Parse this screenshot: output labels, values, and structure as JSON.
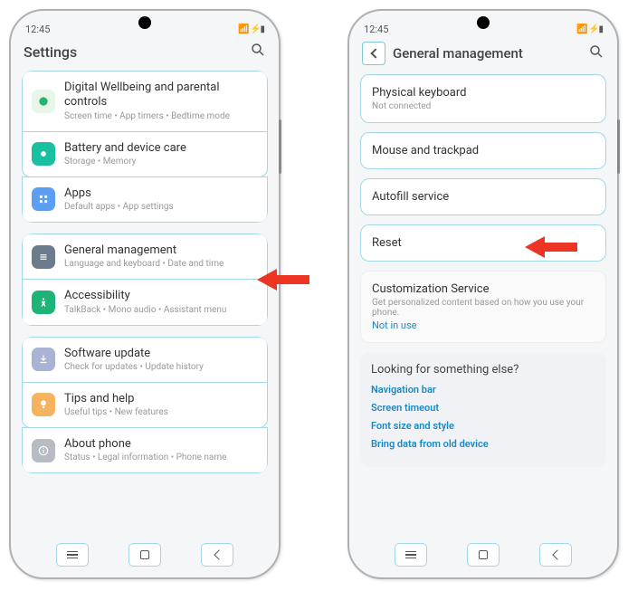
{
  "status": {
    "time": "12:45"
  },
  "left": {
    "header": {
      "title": "Settings"
    },
    "items": [
      {
        "icon": "wellbeing",
        "title": "Digital Wellbeing and parental controls",
        "sub": "Screen time • App timers • Bedtime mode"
      },
      {
        "icon": "battery",
        "title": "Battery and device care",
        "sub": "Storage • Memory"
      },
      {
        "icon": "apps",
        "title": "Apps",
        "sub": "Default apps • App settings"
      },
      {
        "icon": "general",
        "title": "General management",
        "sub": "Language and keyboard • Date and time"
      },
      {
        "icon": "access",
        "title": "Accessibility",
        "sub": "TalkBack • Mono audio • Assistant menu"
      },
      {
        "icon": "software",
        "title": "Software update",
        "sub": "Check for updates • Update history"
      },
      {
        "icon": "tips",
        "title": "Tips and help",
        "sub": "Useful tips • New features"
      },
      {
        "icon": "about",
        "title": "About phone",
        "sub": "Status • Legal information • Phone name"
      }
    ]
  },
  "right": {
    "header": {
      "title": "General management"
    },
    "items": [
      {
        "title": "Physical keyboard",
        "sub": "Not connected"
      },
      {
        "title": "Mouse and trackpad"
      },
      {
        "title": "Autofill service"
      },
      {
        "title": "Reset"
      }
    ],
    "custom": {
      "title": "Customization Service",
      "sub": "Get personalized content based on how you use your phone.",
      "status": "Not in use"
    },
    "footer": {
      "heading": "Looking for something else?",
      "links": [
        "Navigation bar",
        "Screen timeout",
        "Font size and style",
        "Bring data from old device"
      ]
    }
  },
  "annotations": {
    "arrow_color": "#ed3524"
  }
}
